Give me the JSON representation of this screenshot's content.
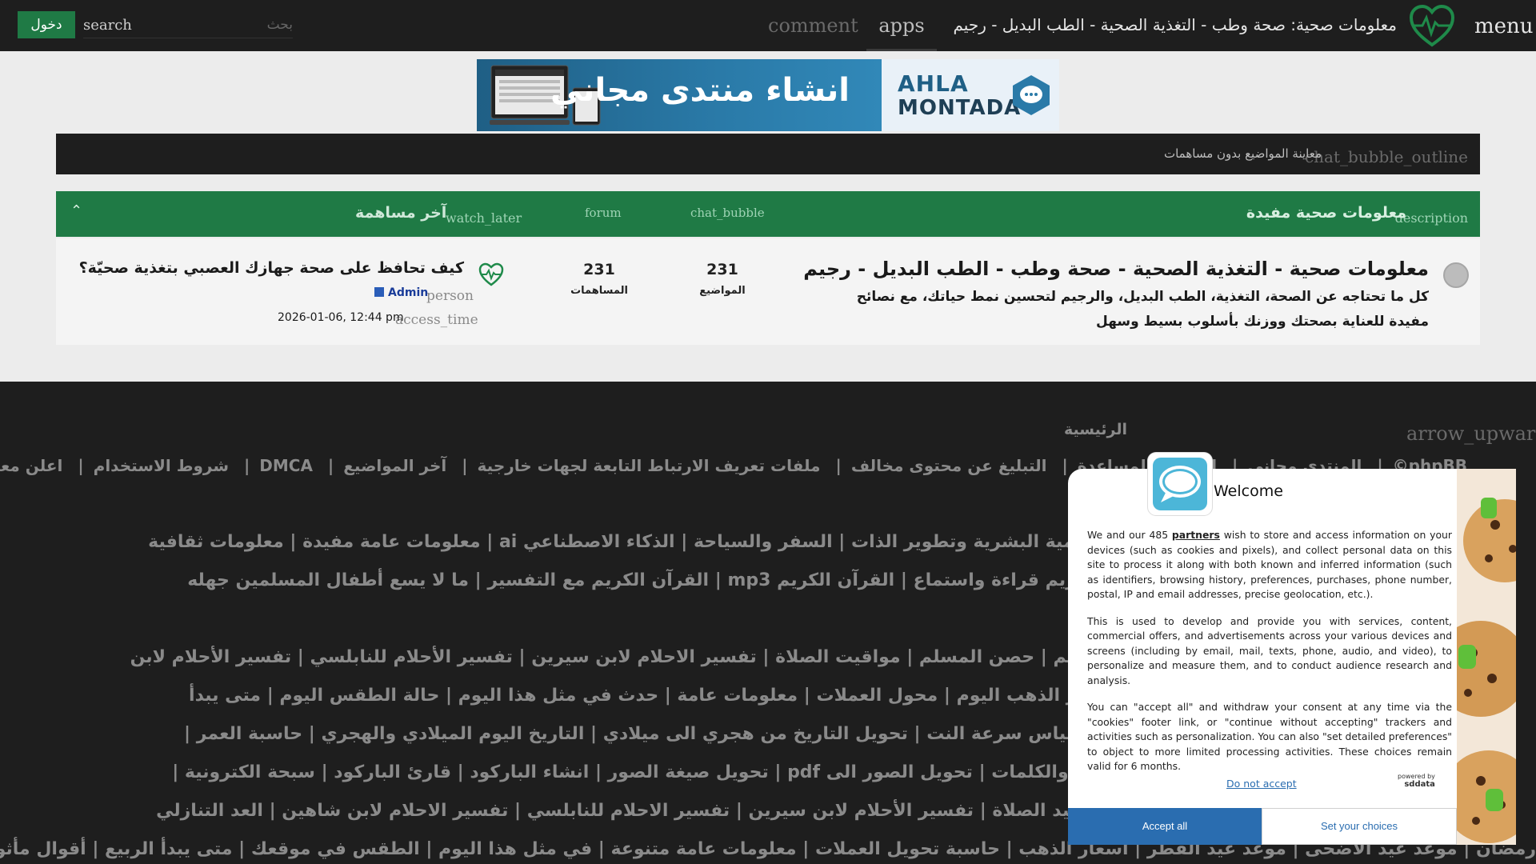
{
  "header": {
    "login_label": "دخول",
    "search_label": "search",
    "search_placeholder": "بحث",
    "nav_comment": "comment",
    "nav_apps": "apps",
    "site_title": "معلومات صحية: صحة وطب - التغذية الصحية - الطب البديل - رجيم",
    "menu_label": "menu"
  },
  "banner": {
    "arabic_text": "انشاء منتدى مجاني",
    "brand_line1": "AHLA",
    "brand_line2": "MONTADA"
  },
  "unanswered": {
    "icon": "chat_bubble_outline",
    "text": "معاينة المواضيع بدون مساهمات"
  },
  "category": {
    "desc_icon": "description",
    "title": "معلومات صحية مفيدة",
    "col_topics_icon": "chat_bubble",
    "col_posts_icon": "forum",
    "col_last_icon": "watch_later",
    "col_last_label": "آخر مساهمة",
    "collapse_icon": "chevron-up-icon"
  },
  "forum": {
    "title": "معلومات صحية - التغذية الصحية - صحة وطب - الطب البديل - رجيم",
    "description": "كل ما تحتاجه عن الصحة، التغذية، الطب البديل، والرجيم لتحسين نمط حياتك، مع نصائح مفيدة للعناية بصحتك ووزنك بأسلوب بسيط وسهل",
    "topics_count": "231",
    "topics_label": "المواضيع",
    "posts_count": "231",
    "posts_label": "المساهمات",
    "last_post_title": "كيف تحافظ على صحة جهازك العصبي بتغذية صحيّة؟",
    "person_icon": "person",
    "last_author": "Admin",
    "time_icon": "access_time",
    "last_time": "2026-01-06, 12:44 pm"
  },
  "footer": {
    "up_icon": "arrow_upward",
    "home_label": "الرئيسية",
    "links": [
      "phpBB©",
      "المنتدى مجاني",
      "الدعم و المساعدة",
      "التبليغ عن محتوى مخالف",
      "ملفات تعريف الارتباط التابعة لجهات خارجية",
      "آخر المواضيع",
      "DMCA",
      "شروط الاستخدام",
      "اعلن معنا"
    ],
    "cat_lines": [
      "معلومات عامة | معلومات صحية | التنمية البشرية وتطوير الذات | السفر والسياحة | الذكاء الاصطناعي ai | معلومات عامة مفيدة | معلومات ثقافية",
      "القرآن الكريم mp3 | القرآن الكريم قراءة واستماع | القرآن الكريم mp3 | القرآن الكريم مع التفسير | ما لا يسع أطفال المسلمين جهله",
      "القرآن الكريم MP3 | إذاعة القرآن الكريم | حصن المسلم | مواقيت الصلاة | تفسير الاحلام لابن سيرين | تفسير الأحلام للنابلسي | تفسير الأحلام لابن",
      "كم باقي على عيد الأضحى | سعر الذهب اليوم | محول العملات | معلومات عامة | حدث في مثل هذا اليوم | حالة الطقس اليوم | متى يبدأ",
      "إنشاء صور بالذكاء الاصطناعي | قياس سرعة النت | تحويل التاريخ من هجري الى ميلادي | التاريخ اليوم الميلادي والهجري | حاسبة العمر |",
      "حساب كتلة الجسم | عداد الحروف والكلمات | تحويل الصور الى pdf | تحويل صيغة الصور | انشاء الباركود | قارئ الباركود | سبحة الكترونية |",
      "القرآن الكريم | حصن المسلم | مواعيد الصلاة | تفسير الأحلام لابن سيرين | تفسير الاحلام للنابلسي | تفسير الاحلام لابن شاهين | العد التنازلي",
      "رمضان | موعد عيد الأضحى | موعد عيد الفطر | أسعار الذهب | حاسبة تحويل العملات | معلومات عامة متنوعة | في مثل هذا اليوم | الطقس في موقعك | متى يبدأ الربيع | أقوال مأثورة | هل تعلم"
    ]
  },
  "consent": {
    "title": "Welcome",
    "para1_pre": "We and our 485 ",
    "partners_link": "partners",
    "para1_post": " wish to store and access information on your devices (such as cookies and pixels), and collect personal data on this site to process it along with both known and inferred information (such as identifiers, browsing history, preferences, purchases, phone number, postal, IP and email addresses, precise geolocation, etc.).",
    "para2": "This is used to develop and provide you with services, content, commercial offers, and advertisements across your various devices and screens (including by email, mail, texts, phone, audio, and video), to personalize and measure them, and to conduct audience research and analysis.",
    "para3": "You can \"accept all\" and withdraw your consent at any time via the \"cookies\" footer link, or \"continue without accepting\" trackers and activities such as personalization. You can also \"set detailed preferences\" to object to more limited processing activities. These choices remain valid for 6 months.",
    "decline_label": "Do not accept",
    "powered_label": "powered by",
    "powered_brand": "sddata",
    "accept_label": "Accept all",
    "choices_label": "Set your choices"
  },
  "colors": {
    "topbar": "#1e1e1e",
    "accent_green": "#1f7a45",
    "consent_blue": "#2a6db0"
  }
}
